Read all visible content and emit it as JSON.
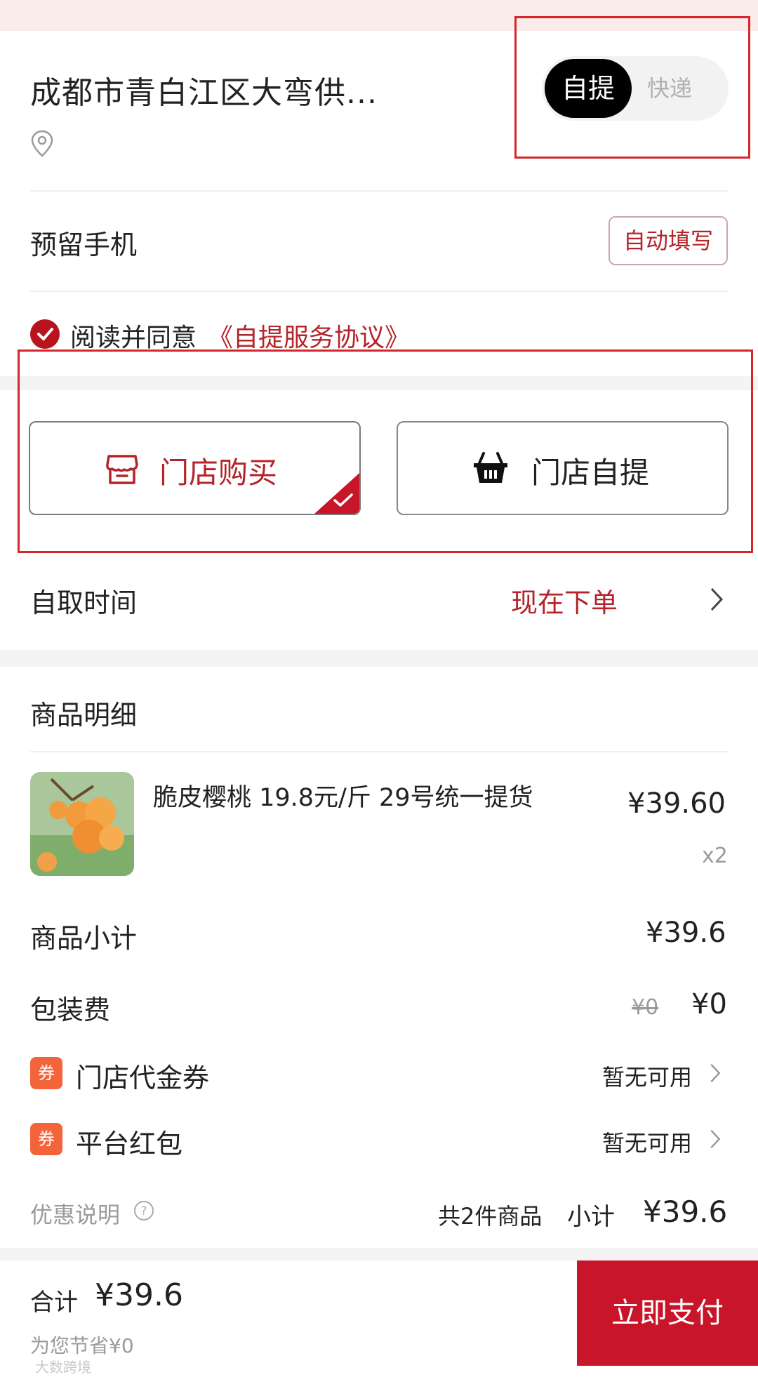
{
  "delivery": {
    "address": "成都市青白江区大弯供...",
    "toggle_selected": "自提",
    "toggle_other": "快递"
  },
  "phone": {
    "label": "预留手机",
    "autofill_label": "自动填写"
  },
  "agreement": {
    "text": "阅读并同意",
    "link": "《自提服务协议》"
  },
  "modes": [
    {
      "label": "门店购买",
      "selected": true
    },
    {
      "label": "门店自提",
      "selected": false
    }
  ],
  "pickup": {
    "label": "自取时间",
    "value": "现在下单"
  },
  "goods": {
    "title": "商品明细",
    "item_name": "脆皮樱桃 19.8元/斤 29号统一提货",
    "item_price": "¥39.60",
    "item_qty": "x2"
  },
  "summary": {
    "subtotal_label": "商品小计",
    "subtotal_value": "¥39.6",
    "packing_label": "包装费",
    "packing_original": "¥0",
    "packing_value": "¥0",
    "coupon_badge": "券",
    "store_coupon_label": "门店代金券",
    "store_coupon_value": "暂无可用",
    "platform_label": "平台红包",
    "platform_value": "暂无可用",
    "discount_note": "优惠说明",
    "count_text": "共2件商品",
    "small_total_label": "小计",
    "small_total_value": "¥39.6"
  },
  "footer": {
    "total_label": "合计",
    "total_value": "¥39.6",
    "saved_text": "为您节省¥0",
    "pay_button": "立即支付",
    "watermark": "大数跨境"
  },
  "colors": {
    "accent": "#b4242a",
    "pay_bg": "#c8152a",
    "coupon_bg": "#f4643a",
    "highlight": "#d4262c"
  }
}
